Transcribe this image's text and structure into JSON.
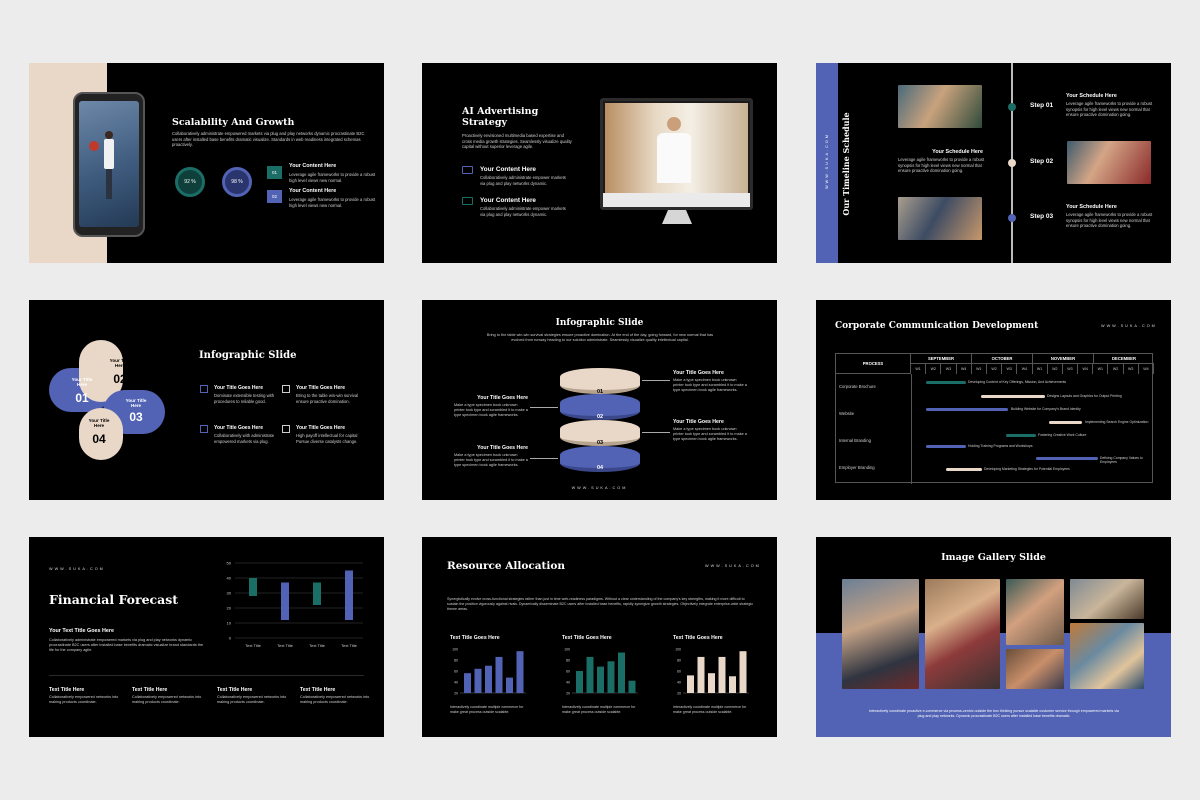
{
  "colors": {
    "blue": "#5263b5",
    "teal": "#1a6e66",
    "beige": "#e9d8c8",
    "dark": "#000000"
  },
  "website": "WWW.SUKA.COM",
  "s1": {
    "title": "Scalability And Growth",
    "body": "Collaboratively administrate empowered markets via plug and play networks dynamic procrastinate B2C users after installed base benefits dramatic visualize. Standards in web readiness integrated schemas proactively.",
    "ring1": "92 %",
    "ring2": "98 %",
    "items": [
      {
        "num": "01",
        "title": "Your Content Here",
        "text": "Leverage agile frameworks to provide a robust high level views new normal."
      },
      {
        "num": "02",
        "title": "Your Content Here",
        "text": "Leverage agile frameworks to provide a robust high level views new normal."
      }
    ]
  },
  "s2": {
    "title_l1": "AI Advertising",
    "title_l2": "Strategy",
    "body": "Proactively envisioned multimedia based expertise and cross media growth strategies. Seamlessly visualize quality capital without superior leverage agile.",
    "items": [
      {
        "title": "Your Content Here",
        "text": "Collaboratively administrate empower markets via plug and play networks dynamic."
      },
      {
        "title": "Your Content Here",
        "text": "Collaboratively administrate empower markets via plug and play networks dynamic."
      }
    ]
  },
  "s3": {
    "title": "Our Timeline Schedule",
    "steps": [
      {
        "label": "Step 01",
        "title": "Your Schedule Here",
        "text": "Leverage agile frameworks to provide a robust synopsis for high level views new normal that ensure proactive domination going."
      },
      {
        "label": "Step 02",
        "title": "Your Schedule Here",
        "text": "Leverage agile frameworks to provide a robust synopsis for high level views new normal that ensure proactive domination going."
      },
      {
        "label": "Step 03",
        "title": "Your Schedule Here",
        "text": "Leverage agile frameworks to provide a robust synopsis for high level views new normal that ensure proactive domination going."
      }
    ]
  },
  "s4": {
    "title": "Infographic Slide",
    "petals": [
      {
        "num": "01",
        "label": "Your Title Here"
      },
      {
        "num": "02",
        "label": "Your Title Here"
      },
      {
        "num": "03",
        "label": "Your Title Here"
      },
      {
        "num": "04",
        "label": "Your Title Here"
      }
    ],
    "items": [
      {
        "title": "Your Title Goes Here",
        "text": "Dominate extensible testing with procedures to reliable good."
      },
      {
        "title": "Your Title Goes Here",
        "text": "Bring to the table win-win survival ensure proactive domination."
      },
      {
        "title": "Your Title Goes Here",
        "text": "Collaboratively with administrate empowered markets via plug."
      },
      {
        "title": "Your Title Goes Here",
        "text": "High payoff intellectual for capital Pursue diverse catalysts change."
      }
    ]
  },
  "s5": {
    "title": "Infographic Slide",
    "body": "Bring to the table win-win survival strategies ensure proactive domination. At the end of the day, going forward, for new normal that has evolved from runway heading to our solution administrate. Seamlessly visualize quality intellectual capital.",
    "layers": [
      "01",
      "02",
      "03",
      "04"
    ],
    "left": [
      {
        "title": "Your Title Goes Here",
        "text": "Make a type specimen book unknown printer took type and scrambled it to make a type specimen book agile frameworks."
      },
      {
        "title": "Your Title Goes Here",
        "text": "Make a type specimen book unknown printer took type and scrambled it to make a type specimen book agile frameworks."
      }
    ],
    "right": [
      {
        "title": "Your Title Goes Here",
        "text": "Make a type specimen book unknown printer took type and scrambled it to make a type specimen book agile frameworks."
      },
      {
        "title": "Your Title Goes Here",
        "text": "Make a type specimen book unknown printer took type and scrambled it to make a type specimen book agile frameworks."
      }
    ]
  },
  "s6": {
    "title": "Corporate Communication Development",
    "process": "PROCESS",
    "months": [
      "SEPTEMBER",
      "OCTOBER",
      "NOVEMBER",
      "DECEMBER"
    ],
    "weeks": [
      "W1",
      "W2",
      "W3",
      "W4"
    ],
    "rows": [
      "Corporate Brochure",
      "Website",
      "Internal Branding",
      "Employer Branding"
    ],
    "bars": [
      {
        "text": "Developing Content of Key Offerings, Mission, And Achievements",
        "color": "#1a6e66"
      },
      {
        "text": "Designs Layouts and Graphics for Output Printing",
        "color": "#e9d8c8"
      },
      {
        "text": "Building Website for Company's Brand Identity",
        "color": "#5263b5"
      },
      {
        "text": "Implementing Search Engine Optimization",
        "color": "#e9d8c8"
      },
      {
        "text": "Fostering Creative Work Culture",
        "color": "#1a6e66"
      },
      {
        "text": "Holding Training Programs and Workshops",
        "color": "#5263b5"
      },
      {
        "text": "Defining Company Values to Employees",
        "color": "#5263b5"
      },
      {
        "text": "Developing Marketing Strategies for Potential Employees",
        "color": "#e9d8c8"
      }
    ]
  },
  "s7": {
    "title": "Financial Forecast",
    "subtitle": "Your Text Title Goes Here",
    "body": "Collaboratively administrate empowered markets via plug and play networks dynamic procrastinate B2C users after installed base benefits dramatic visualize brand standards the life for the company agile.",
    "yticks": [
      "50",
      "40",
      "30",
      "20",
      "10",
      "0"
    ],
    "xlabels": [
      "Text Title",
      "Text Title",
      "Text Title",
      "Text Title"
    ],
    "footer": [
      {
        "title": "Text Title Here",
        "text": "Collaboratively empowered networks into making products coordinate."
      },
      {
        "title": "Text Title Here",
        "text": "Collaboratively empowered networks into making products coordinate."
      },
      {
        "title": "Text Title Here",
        "text": "Collaboratively empowered networks into making products coordinate."
      },
      {
        "title": "Text Title Here",
        "text": "Collaboratively empowered networks into making products coordinate."
      }
    ]
  },
  "s8": {
    "title": "Resource Allocation",
    "body": "Synergistically evolve cross-functional strategies rather than just in time web-readiness paradigms. Without a clear understanding of the company's key strengths, making it more difficult to sustain the position vigorously against rivals. Dynamically disseminate B2C users after installed base benefits, rapidly synergize growth strategies. Objectively integrate enterprise-wide strategic theme areas.",
    "charts": [
      {
        "title": "Text Title Goes Here",
        "labels": [
          "100",
          "80",
          "60",
          "40",
          "20"
        ],
        "text": "Interactively coordinate multiple commerce for make great process outside scalable.",
        "color": "#5263b5"
      },
      {
        "title": "Text Title Goes Here",
        "labels": [
          "100",
          "80",
          "60",
          "40",
          "20"
        ],
        "text": "Interactively coordinate multiple commerce for make great process outside scalable.",
        "color": "#1a6e66"
      },
      {
        "title": "Text Title Goes Here",
        "labels": [
          "100",
          "80",
          "60",
          "40",
          "20"
        ],
        "text": "Interactively coordinate multiple commerce for make great process outside scalable.",
        "color": "#e9d8c8"
      }
    ]
  },
  "s9": {
    "title": "Image Gallery Slide",
    "body": "Interactively coordinate proactive e-commerce via process-centric outside the box thinking pursue scalable customer service through empowered markets via plug and play networks. Dynamic procrastinate B2C users after installed base benefits dramatic."
  }
}
